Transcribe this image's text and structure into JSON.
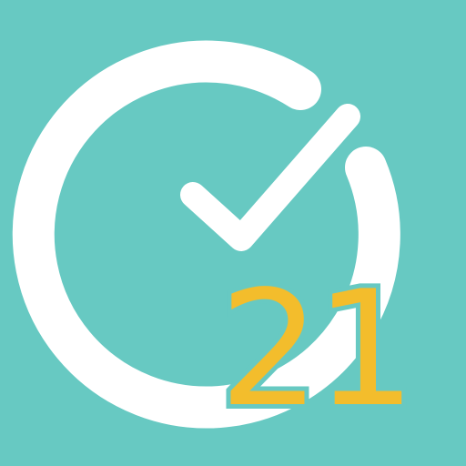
{
  "icon": {
    "name": "app-icon",
    "digits": "21",
    "colors": {
      "background": "#67c9c2",
      "ring": "#ffffff",
      "checkmark": "#ffffff",
      "digits": "#f3bd2c"
    }
  }
}
